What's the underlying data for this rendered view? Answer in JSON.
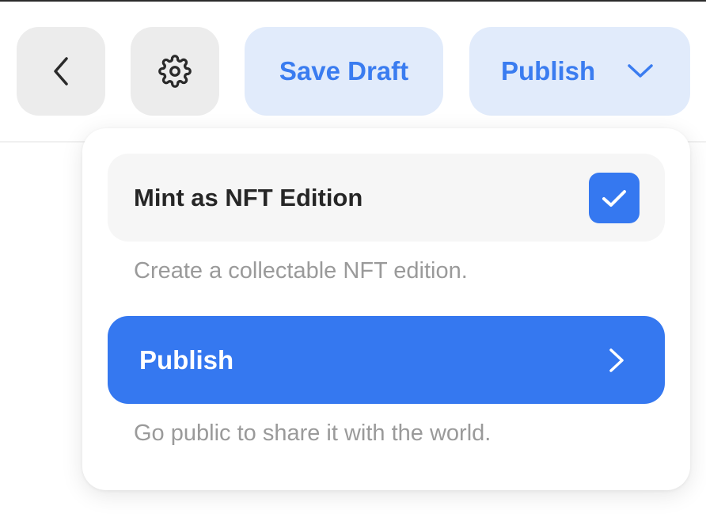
{
  "toolbar": {
    "back_icon": "chevron-left-icon",
    "settings_icon": "gear-icon",
    "save_draft_label": "Save Draft",
    "publish_label": "Publish",
    "publish_menu_icon": "chevron-down-icon"
  },
  "publish_menu": {
    "nft_option": {
      "label": "Mint as NFT Edition",
      "checked": true,
      "description": "Create a collectable NFT edition."
    },
    "publish_option": {
      "label": "Publish",
      "description": "Go public to share it with the world.",
      "icon": "chevron-right-icon"
    }
  },
  "colors": {
    "accent": "#3578f0",
    "accent_soft": "#e1ebfb",
    "neutral_button": "#ececec"
  }
}
